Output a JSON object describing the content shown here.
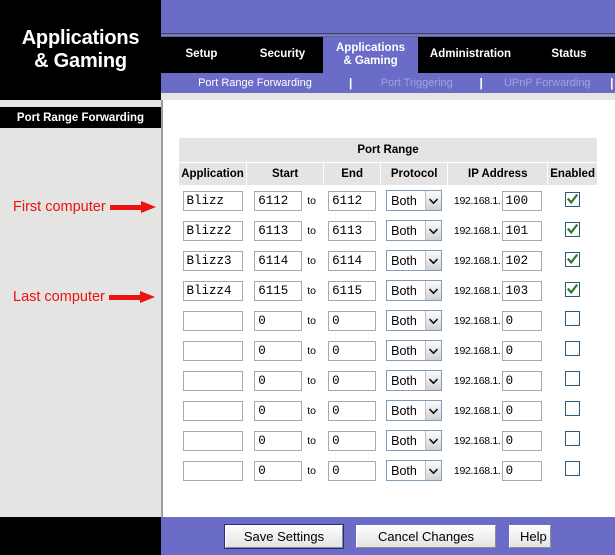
{
  "brand": {
    "title": "Applications\n& Gaming"
  },
  "nav": {
    "tabs": [
      {
        "label": "Setup",
        "active": false
      },
      {
        "label": "Security",
        "active": false
      },
      {
        "label": "Applications\n& Gaming",
        "active": true
      },
      {
        "label": "Administration",
        "active": false
      },
      {
        "label": "Status",
        "active": false
      }
    ],
    "sub_tabs": [
      {
        "label": "Port Range Forwarding",
        "active": true
      },
      {
        "label": "Port Triggering",
        "active": false
      },
      {
        "label": "UPnP Forwarding",
        "active": false
      }
    ],
    "separator": "|"
  },
  "sidebar": {
    "heading": "Port Range Forwarding",
    "annotations": [
      {
        "text": "First computer"
      },
      {
        "text": "Last computer"
      }
    ]
  },
  "table": {
    "group_header": "Port Range",
    "columns": [
      "Application",
      "Start",
      "End",
      "Protocol",
      "IP Address",
      "Enabled"
    ],
    "to_label": "to",
    "ip_prefix": "192.168.1.",
    "protocol_selected": "Both",
    "rows": [
      {
        "application": "Blizz",
        "start": "6112",
        "end": "6112",
        "protocol": "Both",
        "ip_last": "100",
        "enabled": true
      },
      {
        "application": "Blizz2",
        "start": "6113",
        "end": "6113",
        "protocol": "Both",
        "ip_last": "101",
        "enabled": true
      },
      {
        "application": "Blizz3",
        "start": "6114",
        "end": "6114",
        "protocol": "Both",
        "ip_last": "102",
        "enabled": true
      },
      {
        "application": "Blizz4",
        "start": "6115",
        "end": "6115",
        "protocol": "Both",
        "ip_last": "103",
        "enabled": true
      },
      {
        "application": "",
        "start": "0",
        "end": "0",
        "protocol": "Both",
        "ip_last": "0",
        "enabled": false
      },
      {
        "application": "",
        "start": "0",
        "end": "0",
        "protocol": "Both",
        "ip_last": "0",
        "enabled": false
      },
      {
        "application": "",
        "start": "0",
        "end": "0",
        "protocol": "Both",
        "ip_last": "0",
        "enabled": false
      },
      {
        "application": "",
        "start": "0",
        "end": "0",
        "protocol": "Both",
        "ip_last": "0",
        "enabled": false
      },
      {
        "application": "",
        "start": "0",
        "end": "0",
        "protocol": "Both",
        "ip_last": "0",
        "enabled": false
      },
      {
        "application": "",
        "start": "0",
        "end": "0",
        "protocol": "Both",
        "ip_last": "0",
        "enabled": false
      }
    ]
  },
  "buttons": {
    "save": "Save Settings",
    "cancel": "Cancel Changes",
    "help": "Help"
  },
  "colors": {
    "accent_purple": "#6b6bc8",
    "annotation_red": "#ee1111",
    "check_green": "#2b7a2b",
    "header_grey": "#e4e4e4"
  }
}
